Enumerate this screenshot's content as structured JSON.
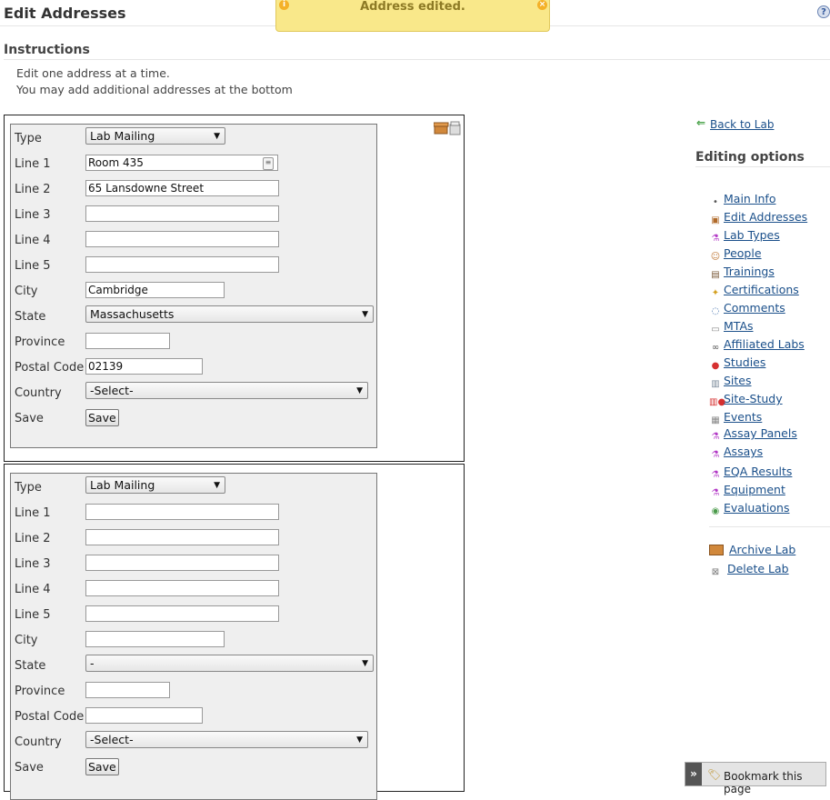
{
  "page": {
    "title": "Edit Addresses"
  },
  "toast": {
    "message": "Address edited."
  },
  "instructions": {
    "title": "Instructions",
    "lines": [
      "Edit one address at a time.",
      "You may add additional addresses at the bottom"
    ]
  },
  "labels": {
    "type": "Type",
    "line1": "Line 1",
    "line2": "Line 2",
    "line3": "Line 3",
    "line4": "Line 4",
    "line5": "Line 5",
    "city": "City",
    "state": "State",
    "province": "Province",
    "postal": "Postal Code",
    "country": "Country",
    "save": "Save"
  },
  "forms": [
    {
      "type": "Lab Mailing",
      "line1": "Room 435",
      "line2": "65 Lansdowne Street",
      "line3": "",
      "line4": "",
      "line5": "",
      "city": "Cambridge",
      "state": "Massachusetts",
      "province": "",
      "postal": "02139",
      "country": "-Select-",
      "save_label": "Save"
    },
    {
      "type": "Lab Mailing",
      "line1": "",
      "line2": "",
      "line3": "",
      "line4": "",
      "line5": "",
      "city": "",
      "state": "-",
      "province": "",
      "postal": "",
      "country": "-Select-",
      "save_label": "Save"
    }
  ],
  "sidebar": {
    "back": "Back to Lab",
    "title": "Editing options",
    "items": [
      {
        "label": "Main Info",
        "icon": "dot-icon"
      },
      {
        "label": "Edit Addresses",
        "icon": "truck-icon"
      },
      {
        "label": "Lab Types",
        "icon": "flask-icon"
      },
      {
        "label": "People",
        "icon": "person-icon"
      },
      {
        "label": "Trainings",
        "icon": "book-icon"
      },
      {
        "label": "Certifications",
        "icon": "certificate-icon"
      },
      {
        "label": "Comments",
        "icon": "comment-icon"
      },
      {
        "label": "MTAs",
        "icon": "document-icon"
      },
      {
        "label": "Affiliated Labs",
        "icon": "link-icon"
      },
      {
        "label": "Studies",
        "icon": "pill-icon"
      },
      {
        "label": "Sites",
        "icon": "building-icon"
      },
      {
        "label": "Site-Study",
        "icon": "building-pill-icon"
      },
      {
        "label": "Events",
        "icon": "calendar-icon"
      },
      {
        "label": "Assay Panels",
        "icon": "flask-icon"
      },
      {
        "label": "Assays",
        "icon": "flask-icon"
      },
      {
        "label": "EQA Results",
        "icon": "flask-icon"
      },
      {
        "label": "Equipment",
        "icon": "flask-icon"
      },
      {
        "label": "Evaluations",
        "icon": "beaker-icon"
      }
    ],
    "archive": "Archive Lab",
    "delete": "Delete Lab"
  },
  "bookmark": {
    "label": "Bookmark this page"
  },
  "colors": {
    "link": "#1a4f8a",
    "toast_bg": "#f9e88a",
    "form_bg": "#efefef"
  }
}
